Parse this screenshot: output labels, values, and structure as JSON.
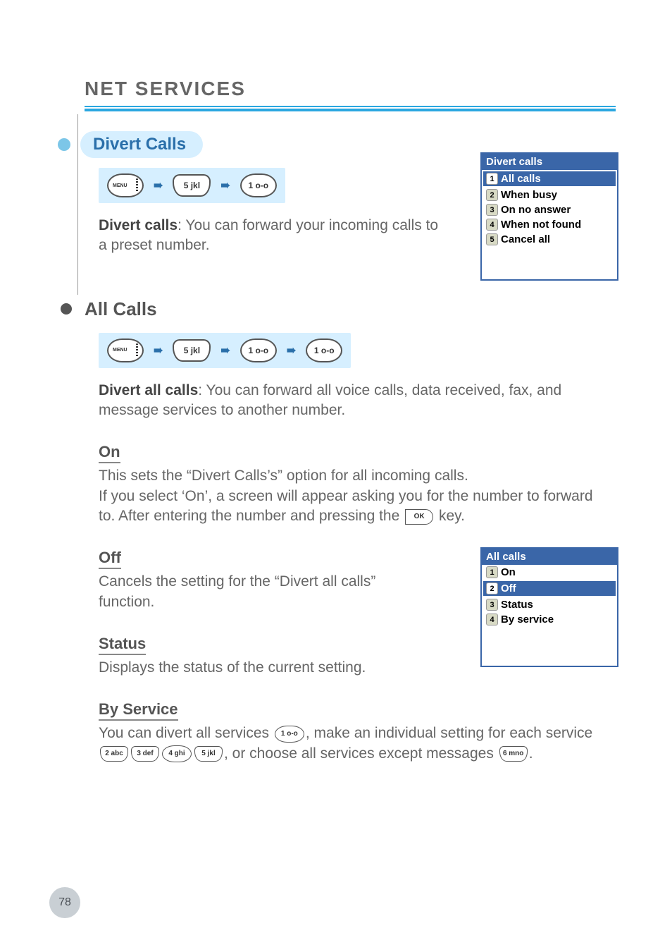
{
  "chapter_title": "NET SERVICES",
  "page_number": "78",
  "section_pill": "Divert Calls",
  "nav1": {
    "k1": "5 jkl",
    "k2": "1 o-o"
  },
  "divert_desc_bold": "Divert calls",
  "divert_desc_rest": ": You can forward your incoming calls to a preset number.",
  "phonebox1": {
    "title": "Divert calls",
    "items": [
      {
        "n": "1",
        "label": "All calls",
        "hl": true
      },
      {
        "n": "2",
        "label": "When busy"
      },
      {
        "n": "3",
        "label": "On no answer"
      },
      {
        "n": "4",
        "label": "When not found"
      },
      {
        "n": "5",
        "label": "Cancel all"
      }
    ]
  },
  "h2_allcalls": "All Calls",
  "nav2": {
    "k1": "5 jkl",
    "k2": "1 o-o",
    "k3": "1 o-o"
  },
  "divert_all_bold": "Divert all calls",
  "divert_all_rest": ": You can forward all voice calls, data received, fax, and message services to another number.",
  "sub_on": "On",
  "on_p1": "This sets the “Divert Calls’s” option for all incoming calls.",
  "on_p2a": "If you select ‘On’, a screen will appear asking you for the number to forward to. After entering the number and pressing the ",
  "on_p2b": " key.",
  "sub_off": "Off",
  "off_p": "Cancels the setting for the “Divert all calls” function.",
  "sub_status": "Status",
  "status_p": "Displays the status of the current setting.",
  "sub_byservice": "By Service",
  "bys_a": "You can divert all services ",
  "bys_b": ", make an individual setting for each service ",
  "bys_c": ", or choose all services except messages ",
  "bys_d": ".",
  "phonebox2": {
    "title": "All calls",
    "items": [
      {
        "n": "1",
        "label": "On"
      },
      {
        "n": "2",
        "label": "Off",
        "hl": true
      },
      {
        "n": "3",
        "label": "Status"
      },
      {
        "n": "4",
        "label": "By service"
      }
    ]
  },
  "ikeys": {
    "k1": "1 o-o",
    "k2": "2 abc",
    "k3": "3 def",
    "k4": "4 ghi",
    "k5": "5 jkl",
    "k6": "6 mno",
    "ok": "OK"
  },
  "arrow": "➠"
}
